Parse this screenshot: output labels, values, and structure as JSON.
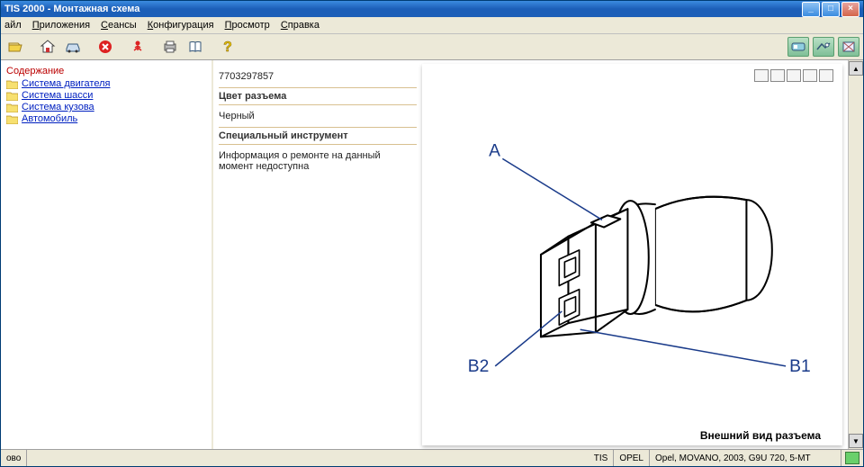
{
  "title": "TIS 2000 - Монтажная схема",
  "menu": {
    "file": "айл",
    "app": "Приложения",
    "sessions": "Сеансы",
    "config": "Конфигурация",
    "view": "Просмотр",
    "help": "Справка"
  },
  "sidebar": {
    "header": "Содержание",
    "items": [
      {
        "label": "Система двигателя"
      },
      {
        "label": "Система шасси"
      },
      {
        "label": "Система кузова"
      },
      {
        "label": "Автомобиль"
      }
    ]
  },
  "info": {
    "partno": "7703297857",
    "color_hdr": "Цвет разъема",
    "color_val": "Черный",
    "tool_hdr": "Специальный инструмент",
    "tool_val": "Информация о ремонте на данный момент недоступна"
  },
  "diagram": {
    "labels": {
      "a": "A",
      "b1": "B1",
      "b2": "B2"
    },
    "caption": "Внешний вид разъема"
  },
  "status": {
    "ready": "ово",
    "tis": "TIS",
    "brand": "OPEL",
    "vehicle": "Opel, MOVANO, 2003, G9U 720, 5-MT"
  }
}
